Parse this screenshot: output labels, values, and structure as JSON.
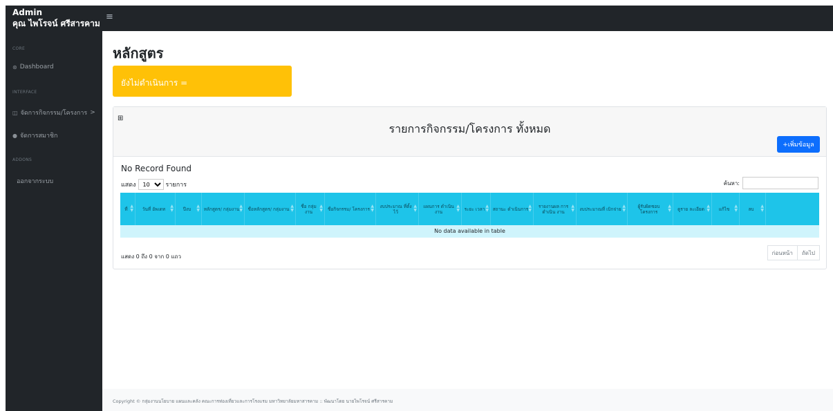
{
  "brand": {
    "line1": "Admin",
    "line2": "คุณ ไพโรจน์ ศรีสารคาม"
  },
  "toggle_icon": "≡",
  "sidebar": {
    "headings": [
      "CORE",
      "INTERFACE",
      "ADDONS"
    ],
    "items": [
      {
        "icon": "dashboard-icon",
        "label": "Dashboard"
      },
      {
        "icon": "columns-icon",
        "label": "จัดการกิจกรรม/โครงการ",
        "caret": ">"
      },
      {
        "icon": "user-icon",
        "label": "จัดการสมาชิก"
      },
      {
        "icon": "",
        "label": "ออกจากระบบ"
      }
    ]
  },
  "page": {
    "title": "หลักสูตร",
    "warning_card": "ยังไม่ดำเนินการ ="
  },
  "card": {
    "header_icon": "table-icon",
    "title": "รายการกิจกรรม/โครงการ ทั้งหมด",
    "add_button": "+เพิ่มข้อมูล",
    "no_record": "No Record Found",
    "length_prefix": "แสดง",
    "length_value": "10",
    "length_suffix": "รายการ",
    "search_label": "ค้นหา:",
    "search_placeholder": "",
    "columns": [
      "ที่",
      "วันที่ อัพเดท",
      "ปีงบ",
      "หลักสูตร/ กลุ่มงาน",
      "ชื่อหลักสูตร/ กลุ่มงาน",
      "ชื่อ กลุ่ม งาน",
      "ชื่อกิจกรรม/ โครงการ",
      "งบประมาณ ที่ตั้งไว้",
      "แผนการ ดำเนินงาน",
      "ระยะ เวลา",
      "สถานะ ดำเนินการ",
      "รายงานผล การดำเนิน งาน",
      "งบประมาณที่ เบิกจ่าย",
      "ผู้รับผิดชอบ โครงการ",
      "ดูราย ละเอียด",
      "แก้ไข",
      "ลบ"
    ],
    "empty_message": "No data available in table",
    "info": "แสดง 0 ถึง 0 จาก 0 แถว",
    "pager_prev": "ก่อนหน้า",
    "pager_next": "ถัดไป"
  },
  "footer": "Copyright © กลุ่มงานนโยบาย แผนและคลัง คณะการท่องเที่ยวและการโรงแรม มหาวิทยาลัยมหาสารคาม :: พัฒนาโดย นายไพโรจน์ ศรีสารคาม",
  "colors": {
    "sidebar": "#212529",
    "warning": "#ffc107",
    "primary": "#0d6efd",
    "table_header": "#1ec4e9",
    "empty_row": "#cff4fc"
  }
}
